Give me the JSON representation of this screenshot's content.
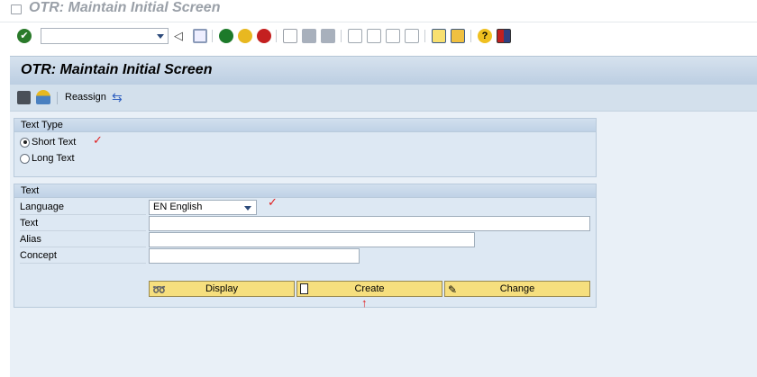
{
  "window": {
    "title": "OTR: Maintain Initial Screen"
  },
  "system_toolbar": {
    "command_field": "",
    "icons": [
      "enter-icon",
      "back-icon",
      "save-icon",
      "back-green-icon",
      "exit-icon",
      "cancel-icon",
      "print-icon",
      "find-icon",
      "find-next-icon",
      "first-page-icon",
      "previous-page-icon",
      "next-page-icon",
      "last-page-icon",
      "new-session-icon",
      "shortcut-icon",
      "help-icon",
      "layout-icon"
    ]
  },
  "screen": {
    "title": "OTR: Maintain Initial Screen",
    "app_toolbar": {
      "reassign_label": "Reassign"
    },
    "text_type": {
      "title": "Text Type",
      "short_text": "Short Text",
      "long_text": "Long Text",
      "selected": "Short Text"
    },
    "text": {
      "title": "Text",
      "language_label": "Language",
      "language_value": "EN English",
      "text_label": "Text",
      "text_value": "",
      "alias_label": "Alias",
      "alias_value": "",
      "concept_label": "Concept",
      "concept_value": ""
    },
    "buttons": {
      "display": "Display",
      "create": "Create",
      "change": "Change"
    }
  },
  "annotations": {
    "check": "✓",
    "arrow": "↑"
  },
  "colors": {
    "button": "#f6df7e",
    "header": "#bccee2"
  }
}
